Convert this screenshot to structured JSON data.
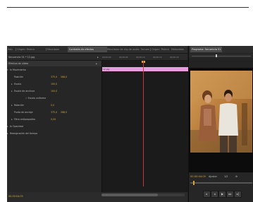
{
  "tabs": [
    "Edic",
    "Origen: Patrick",
    "Mezclador",
    "Controles de efectos",
    "Mezclador de clip de audio: Secuencia 01",
    "Origen: Patrick",
    "Metadatos"
  ],
  "active_tab_index": 3,
  "right_tab": "Programa: Secuencia 01",
  "sequence_label": "Secuencia 01 * 12.jpg",
  "clip_name": "12.jpg",
  "ruler_ticks": [
    "00:00:00",
    "00:00:05",
    "00:00:10",
    "00:00:15",
    "00:00:20"
  ],
  "effects": {
    "header": "Efectos de vídeo",
    "rows": [
      {
        "label": "fx  Movimiento",
        "v1": "",
        "v2": "",
        "indent": 4,
        "icon": "▾"
      },
      {
        "label": "Posición",
        "v1": "375,0",
        "v2": "288,0",
        "indent": 10,
        "icon": ""
      },
      {
        "label": "Escala",
        "v1": "100,0",
        "v2": "",
        "indent": 10,
        "icon": "▸"
      },
      {
        "label": "Escala de anchura",
        "v1": "100,0",
        "v2": "",
        "indent": 10,
        "icon": "▸"
      },
      {
        "label": "✓ Escala uniforme",
        "v1": "",
        "v2": "",
        "indent": 26,
        "icon": ""
      },
      {
        "label": "Rotación",
        "v1": "0,0",
        "v2": "",
        "indent": 10,
        "icon": "▸"
      },
      {
        "label": "Punto de anclaje",
        "v1": "375,0",
        "v2": "288,0",
        "indent": 10,
        "icon": ""
      },
      {
        "label": "Filtro antiparpadeo",
        "v1": "0,00",
        "v2": "",
        "indent": 10,
        "icon": "▸"
      },
      {
        "label": "fx  Opacidad",
        "v1": "",
        "v2": "",
        "indent": 4,
        "icon": "▸"
      },
      {
        "label": "Reasignación del tiempo",
        "v1": "",
        "v2": "",
        "indent": 4,
        "icon": "▸"
      }
    ]
  },
  "timecode_left": "00:00:04:05",
  "monitor": {
    "timecode": "00:00:04:05",
    "fit": "Ajustar",
    "quality": "1/2",
    "transport": [
      "▸",
      "◂",
      "▶",
      "▸▸",
      "▸|"
    ]
  }
}
